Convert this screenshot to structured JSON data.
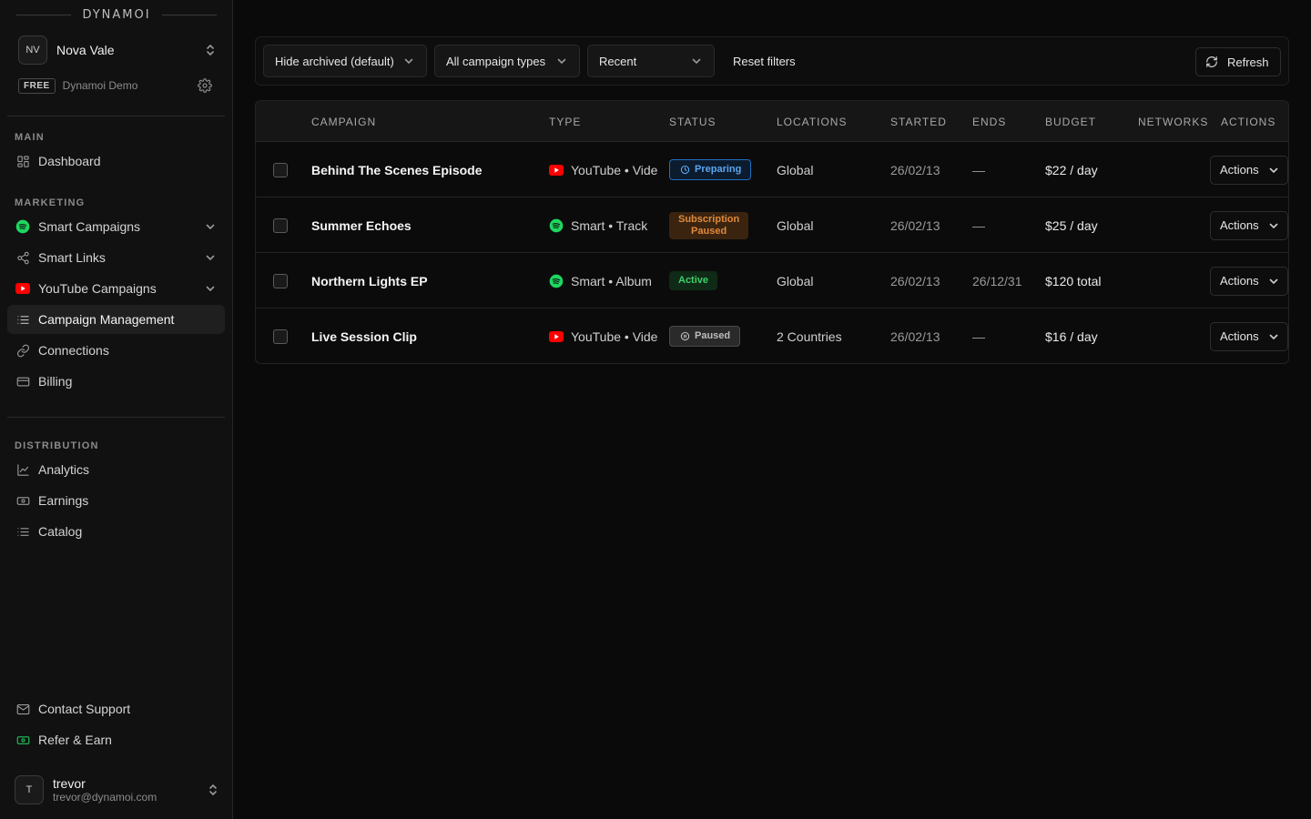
{
  "brand": "DYNAMOI",
  "workspace": {
    "initials": "NV",
    "name": "Nova Vale",
    "plan_badge": "FREE",
    "plan_name": "Dynamoi Demo"
  },
  "nav": {
    "main_label": "MAIN",
    "marketing_label": "MARKETING",
    "distribution_label": "DISTRIBUTION",
    "dashboard": "Dashboard",
    "smart_campaigns": "Smart Campaigns",
    "smart_links": "Smart Links",
    "youtube_campaigns": "YouTube Campaigns",
    "campaign_management": "Campaign Management",
    "connections": "Connections",
    "billing": "Billing",
    "analytics": "Analytics",
    "earnings": "Earnings",
    "catalog": "Catalog",
    "contact_support": "Contact Support",
    "refer_earn": "Refer & Earn"
  },
  "user": {
    "initial": "T",
    "name": "trevor",
    "email": "trevor@dynamoi.com"
  },
  "filters": {
    "archived": "Hide archived (default)",
    "types": "All campaign types",
    "sort": "Recent",
    "reset": "Reset filters",
    "refresh": "Refresh"
  },
  "table": {
    "headers": {
      "campaign": "CAMPAIGN",
      "type": "TYPE",
      "status": "STATUS",
      "locations": "LOCATIONS",
      "started": "STARTED",
      "ends": "ENDS",
      "budget": "BUDGET",
      "networks": "NETWORKS",
      "actions": "ACTIONS"
    },
    "rows": [
      {
        "name": "Behind The Scenes Episode",
        "platform": "youtube",
        "type": "YouTube • Video",
        "status": "Preparing",
        "status_line2": "",
        "location": "Global",
        "started": "26/02/13",
        "ends": "—",
        "budget": "$22 / day",
        "networks": "",
        "action": "Actions"
      },
      {
        "name": "Summer Echoes",
        "platform": "spotify",
        "type": "Smart • Track",
        "status": "Subscription",
        "status_line2": "Paused",
        "location": "Global",
        "started": "26/02/13",
        "ends": "—",
        "budget": "$25 / day",
        "networks": "",
        "action": "Actions"
      },
      {
        "name": "Northern Lights EP",
        "platform": "spotify",
        "type": "Smart • Album",
        "status": "Active",
        "status_line2": "",
        "location": "Global",
        "started": "26/02/13",
        "ends": "26/12/31",
        "budget": "$120 total",
        "networks": "",
        "action": "Actions"
      },
      {
        "name": "Live Session Clip",
        "platform": "youtube",
        "type": "YouTube • Video",
        "status": "Paused",
        "status_line2": "",
        "location": "2 Countries",
        "started": "26/02/13",
        "ends": "—",
        "budget": "$16 / day",
        "networks": "",
        "action": "Actions"
      }
    ]
  },
  "colors": {
    "spotify": "#1ed760",
    "youtube": "#ff0000",
    "refer_icon": "#22c55e",
    "background": "#0a0a0a",
    "sidebar": "#111111"
  }
}
